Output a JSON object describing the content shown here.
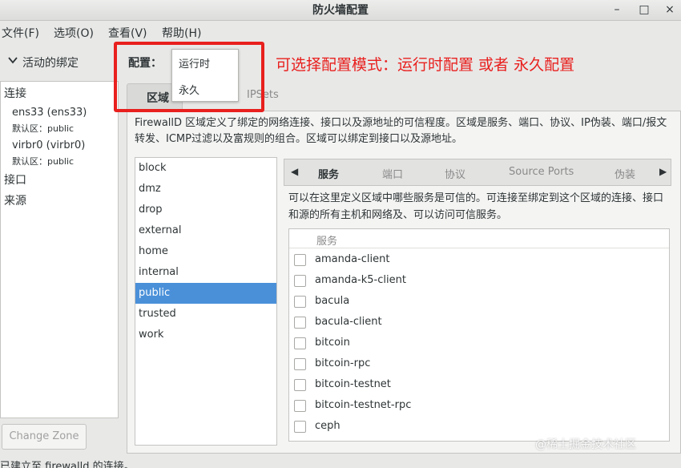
{
  "window": {
    "title": "防火墙配置",
    "minimize_glyph": "–",
    "maximize_glyph": "□",
    "close_glyph": "×"
  },
  "menu": [
    "文件(F)",
    "选项(O)",
    "查看(V)",
    "帮助(H)"
  ],
  "left_panel": {
    "header": "活动的绑定",
    "header_icon": "chevron-down-icon",
    "connections_label": "连接",
    "interfaces": [
      {
        "name": "ens33 (ens33)",
        "zone": "默认区：public"
      },
      {
        "name": "virbr0 (virbr0)",
        "zone": "默认区：public"
      }
    ],
    "ports_label": "接口",
    "sources_label": "来源",
    "change_zone_button": "Change Zone"
  },
  "config": {
    "label": "配置：",
    "options": [
      "运行时",
      "永久"
    ]
  },
  "annotation": {
    "text": "可选择配置模式：运行时配置 或者 永久配置",
    "color": "#e8201e"
  },
  "main_tabs": {
    "zones": "区域",
    "ipsets": "IPSets"
  },
  "zone_description": "FirewallD 区域定义了绑定的网络连接、接口以及源地址的可信程度。区域是服务、端口、协议、IP伪装、端口/报文转发、ICMP过滤以及富规则的组合。区域可以绑定到接口以及源地址。",
  "zones": [
    "block",
    "dmz",
    "drop",
    "external",
    "home",
    "internal",
    "public",
    "trusted",
    "work"
  ],
  "selected_zone": "public",
  "sub_tabs": {
    "left_arrow": "◀",
    "right_arrow": "▶",
    "labels": [
      "服务",
      "端口",
      "协议",
      "Source Ports",
      "伪装"
    ],
    "active": "服务"
  },
  "services_description": "可以在这里定义区域中哪些服务是可信的。可连接至绑定到这个区域的连接、接口和源的所有主机和网络及、可以访问可信服务。",
  "services_column": "服务",
  "services": [
    "amanda-client",
    "amanda-k5-client",
    "bacula",
    "bacula-client",
    "bitcoin",
    "bitcoin-rpc",
    "bitcoin-testnet",
    "bitcoin-testnet-rpc",
    "ceph"
  ],
  "status": "已建立至 firewalld 的连接。",
  "watermark": "@稀土掘金技术社区",
  "colors": {
    "accent": "#4a90d9",
    "highlight": "#e8201e"
  }
}
